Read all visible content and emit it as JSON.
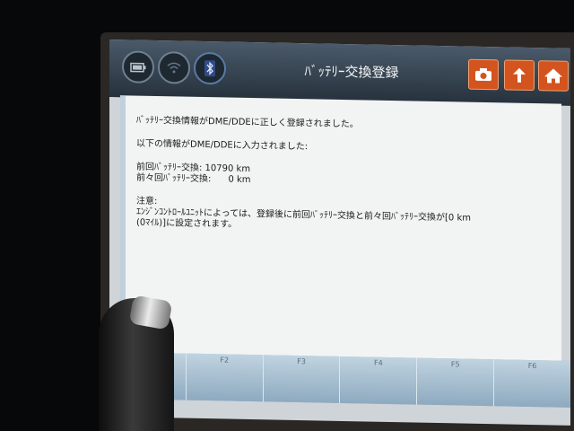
{
  "header": {
    "title": "ﾊﾞｯﾃﾘｰ交換登録",
    "status_icons": [
      "battery-icon",
      "wifi-icon",
      "bluetooth-icon"
    ],
    "buttons": [
      "camera-icon",
      "back-icon",
      "home-icon"
    ]
  },
  "message": {
    "line1": "ﾊﾞｯﾃﾘｰ交換情報がDME/DDEに正しく登録されました。",
    "line2": "以下の情報がDME/DDEに入力されました:",
    "line3": "前回ﾊﾞｯﾃﾘｰ交換:  10790 km",
    "line4": "前々回ﾊﾞｯﾃﾘｰ交換:      0 km",
    "note_title": "注意:",
    "note_line1": "ｴﾝｼﾞﾝｺﾝﾄﾛｰﾙﾕﾆｯﾄによっては、登録後に前回ﾊﾞｯﾃﾘｰ交換と前々回ﾊﾞｯﾃﾘｰ交換が[0 km",
    "note_line2": "(0ﾏｲﾙ)]に設定されます。"
  },
  "function_keys": [
    "",
    "F2",
    "F3",
    "F4",
    "F5",
    "F6"
  ],
  "colors": {
    "accent": "#d3541e",
    "header": "#2f3a45",
    "content_bg": "#f2f4f4"
  }
}
